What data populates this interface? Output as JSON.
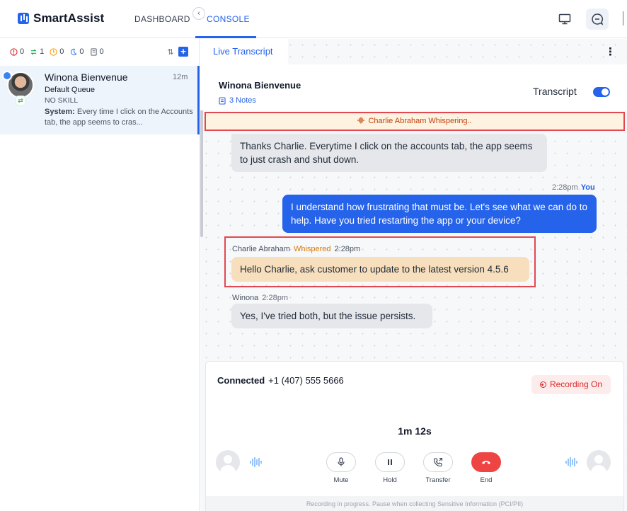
{
  "app": {
    "brand": "SmartAssist"
  },
  "nav": {
    "tabs": [
      {
        "label": "DASHBOARD"
      },
      {
        "label": "CONSOLE"
      }
    ],
    "active_tab": "CONSOLE"
  },
  "queue": {
    "counters": [
      {
        "icon": "alert-icon",
        "value": "0",
        "color": "#dc2626"
      },
      {
        "icon": "transfer-icon",
        "value": "1",
        "color": "#16a34a"
      },
      {
        "icon": "clock-icon",
        "value": "0",
        "color": "#f59e0b"
      },
      {
        "icon": "moon-icon",
        "value": "0",
        "color": "#3b82f6"
      },
      {
        "icon": "notes-icon",
        "value": "0",
        "color": "#6b7280"
      }
    ]
  },
  "conversation": {
    "name": "Winona Bienvenue",
    "time": "12m",
    "queue": "Default Queue",
    "skill": "NO SKILL",
    "system_label": "System:",
    "preview": "Every time I click on the Accounts tab, the app seems to cras..."
  },
  "main": {
    "tab_label": "Live Transcript",
    "customer_name": "Winona Bienvenue",
    "notes_label": "3 Notes",
    "transcript_label": "Transcript",
    "transcript_on": true,
    "whisper_banner": "Charlie Abraham Whispering.."
  },
  "messages": {
    "cust1": {
      "text": "Thanks Charlie. Everytime I click on the accounts tab, the app seems to just crash and shut down."
    },
    "agent": {
      "time": "2:28pm",
      "sender": "You",
      "text": "I understand how frustrating that must be. Let's see what we can do to help. Have you tried restarting the app or your device?"
    },
    "whisper": {
      "sender": "Charlie Abraham",
      "tag": "Whispered",
      "time": "2:28pm",
      "text": "Hello Charlie, ask customer to update to the latest version 4.5.6"
    },
    "cust2": {
      "sender": "Winona",
      "time": "2:28pm",
      "text": "Yes, I've tried both, but the issue persists."
    }
  },
  "call": {
    "status": "Connected",
    "phone": "+1 (407) 555 5666",
    "recording": "Recording On",
    "timer": "1m 12s",
    "controls": {
      "mute": "Mute",
      "hold": "Hold",
      "transfer": "Transfer",
      "end": "End"
    },
    "footer": "Recording in progress. Pause when collecting Sensitive Information (PCI/PII)"
  },
  "colors": {
    "accent": "#2563eb",
    "whisper_orange": "#c2410c",
    "highlight_red": "#e34850",
    "end_red": "#ef4444"
  }
}
